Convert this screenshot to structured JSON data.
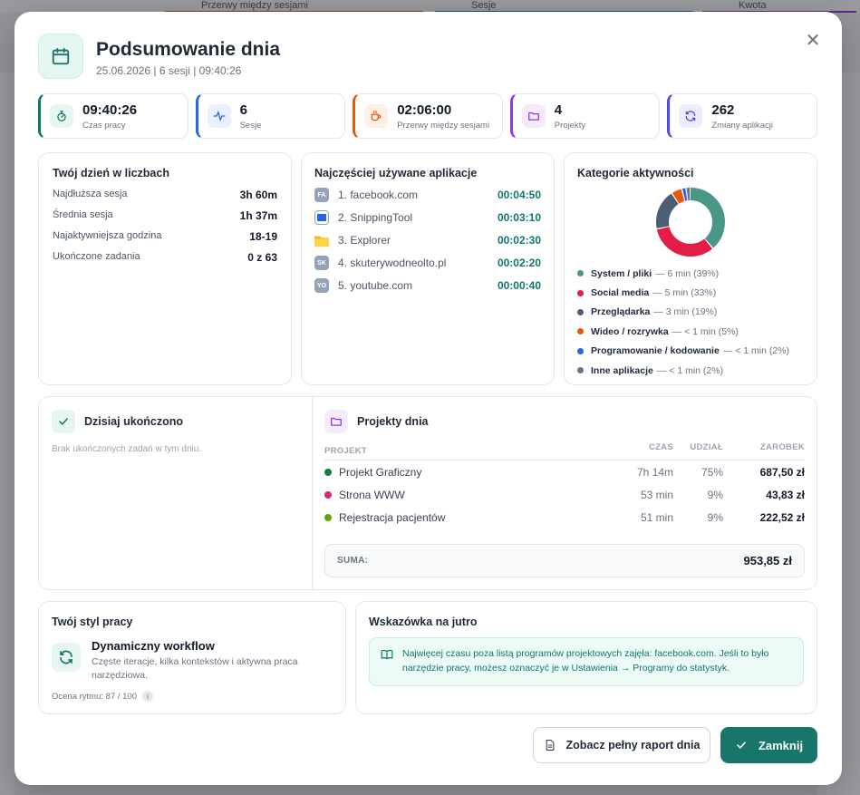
{
  "background": {
    "tabs": [
      "Przerwy między sesjami",
      "Sesje",
      "Kwota"
    ]
  },
  "header": {
    "title": "Podsumowanie dnia",
    "subtitle": "25.06.2026 | 6 sesji | 09:40:26",
    "icon": "calendar-icon"
  },
  "stats": [
    {
      "value": "09:40:26",
      "label": "Czas pracy",
      "icon": "stopwatch-icon",
      "color": "#0f766e"
    },
    {
      "value": "6",
      "label": "Sesje",
      "icon": "activity-icon",
      "color": "#2563eb"
    },
    {
      "value": "02:06:00",
      "label": "Przerwy między sesjami",
      "icon": "coffee-icon",
      "color": "#ea580c"
    },
    {
      "value": "4",
      "label": "Projekty",
      "icon": "folder-icon",
      "color": "#9333ea"
    },
    {
      "value": "262",
      "label": "Zmiany aplikacji",
      "icon": "refresh-icon",
      "color": "#4f46e5"
    }
  ],
  "day_numbers": {
    "title": "Twój dzień w liczbach",
    "rows": [
      {
        "label": "Najdłuższa sesja",
        "value": "3h 60m"
      },
      {
        "label": "Średnia sesja",
        "value": "1h 37m"
      },
      {
        "label": "Najaktywniejsza godzina",
        "value": "18-19"
      },
      {
        "label": "Ukończone zadania",
        "value": "0 z 63"
      }
    ]
  },
  "top_apps": {
    "title": "Najczęściej używane aplikacje",
    "items": [
      {
        "badge": "FA",
        "name": "1. facebook.com",
        "time": "00:04:50"
      },
      {
        "badge": "",
        "name": "2. SnippingTool",
        "time": "00:03:10"
      },
      {
        "badge": "",
        "name": "3. Explorer",
        "time": "00:02:30"
      },
      {
        "badge": "SK",
        "name": "4. skuterywodneolto.pl",
        "time": "00:02:20"
      },
      {
        "badge": "YO",
        "name": "5. youtube.com",
        "time": "00:00:40"
      }
    ]
  },
  "categories": {
    "title": "Kategorie aktywności",
    "items": [
      {
        "name": "System / pliki",
        "detail": "— 6 min (39%)",
        "share": 39,
        "color": "#4a9688"
      },
      {
        "name": "Social media",
        "detail": "— 5 min (33%)",
        "share": 33,
        "color": "#e11d48"
      },
      {
        "name": "Przeglądarka",
        "detail": "— 3 min (19%)",
        "share": 19,
        "color": "#4b5e73"
      },
      {
        "name": "Wideo / rozrywka",
        "detail": "— < 1 min (5%)",
        "share": 5,
        "color": "#ea580c"
      },
      {
        "name": "Programowanie / kodowanie",
        "detail": "— < 1 min (2%)",
        "share": 2,
        "color": "#2563eb"
      },
      {
        "name": "Inne aplikacje",
        "detail": "— < 1 min (2%)",
        "share": 2,
        "color": "#64748b"
      }
    ]
  },
  "completed": {
    "title": "Dzisiaj ukończono",
    "empty": "Brak ukończonych zadań w tym dniu."
  },
  "projects": {
    "title": "Projekty dnia",
    "headers": {
      "name": "PROJEKT",
      "time": "CZAS",
      "share": "UDZIAŁ",
      "earn": "ZAROBEK"
    },
    "rows": [
      {
        "name": "Projekt Graficzny",
        "time": "7h 14m",
        "share": "75%",
        "earn": "687,50 zł",
        "color": "#15803d"
      },
      {
        "name": "Strona WWW",
        "time": "53 min",
        "share": "9%",
        "earn": "43,83 zł",
        "color": "#db2777"
      },
      {
        "name": "Rejestracja pacjentów",
        "time": "51 min",
        "share": "9%",
        "earn": "222,52 zł",
        "color": "#65a30d"
      }
    ],
    "sum_label": "SUMA:",
    "sum_value": "953,85 zł"
  },
  "work_style": {
    "title": "Twój styl pracy",
    "name": "Dynamiczny workflow",
    "description": "Częste iteracje, kilka kontekstów i aktywna praca narzędziowa.",
    "score": "Ocena rytmu: 87 / 100"
  },
  "tip": {
    "title": "Wskazówka na jutro",
    "text": "Najwięcej czasu poza listą programów projektowych zajęła: facebook.com. Jeśli to było narzędzie pracy, możesz oznaczyć je w Ustawienia → Programy do statystyk."
  },
  "buttons": {
    "report": "Zobacz pełny raport dnia",
    "close": "Zamknij"
  },
  "colors": {
    "accent": "#17756a",
    "accent_light": "#e6f6f1"
  }
}
